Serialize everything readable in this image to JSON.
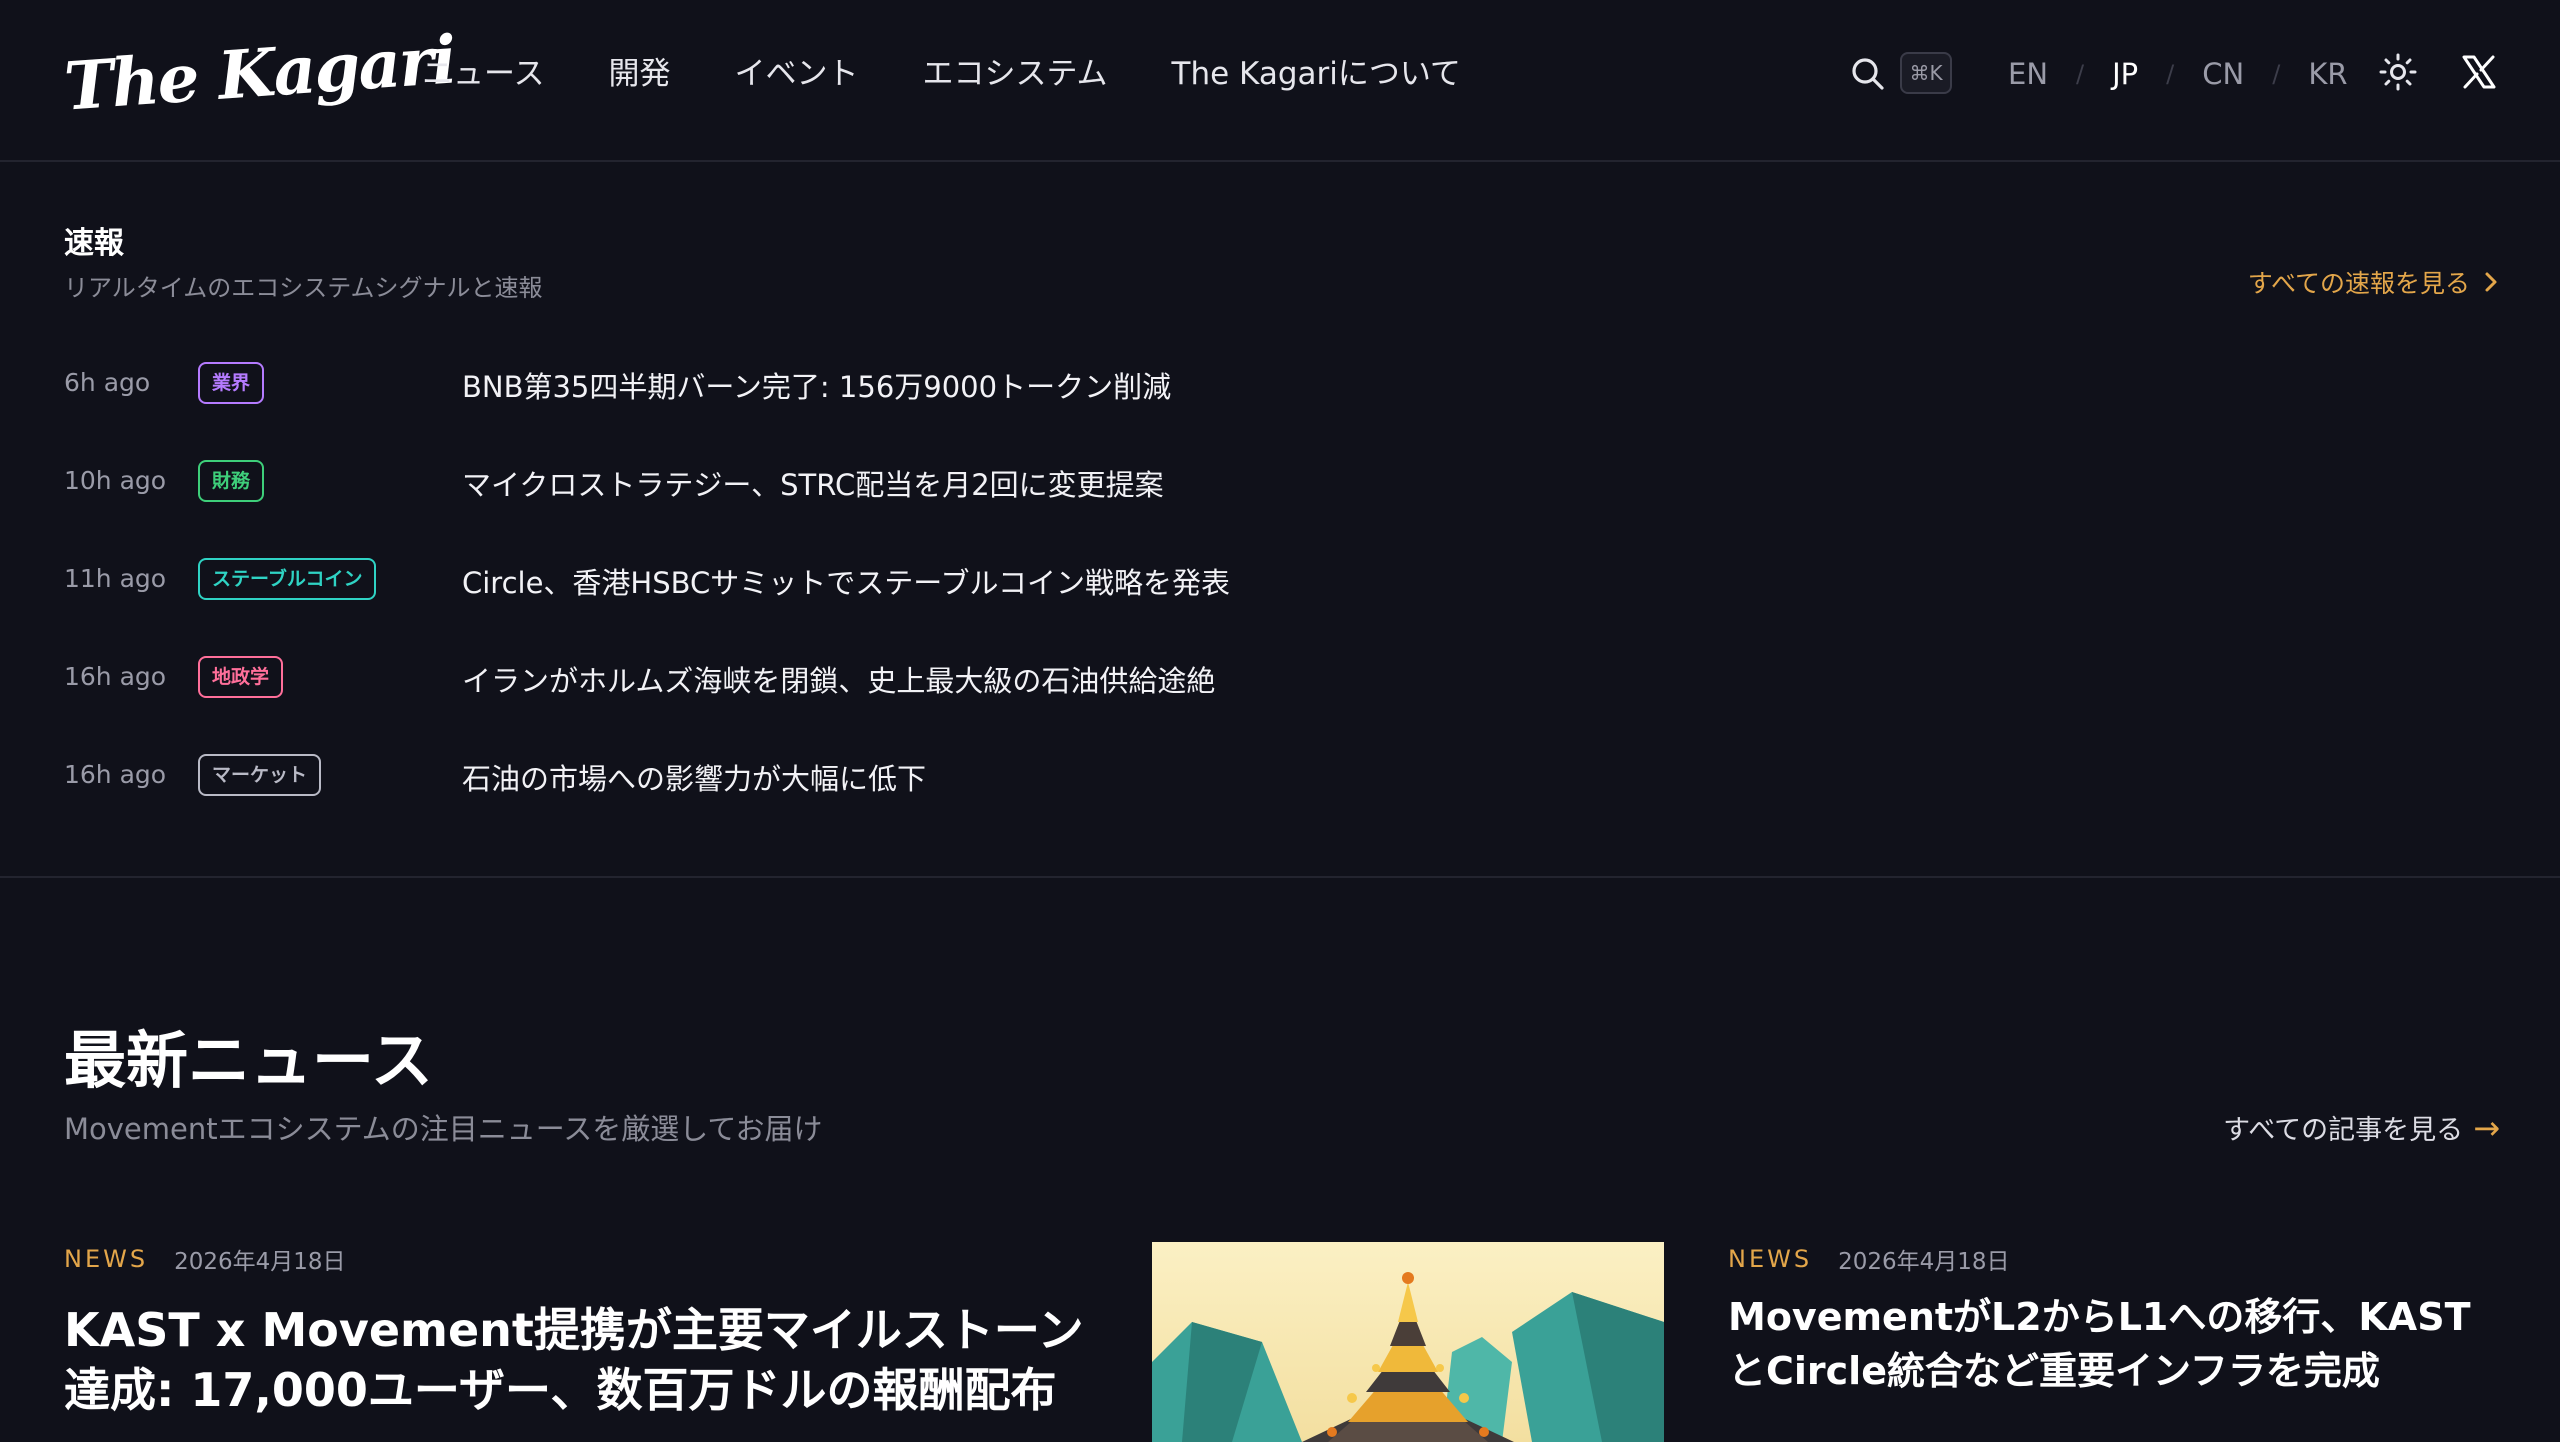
{
  "header": {
    "logo_text": "The Kagari",
    "nav": [
      "ニュース",
      "開発",
      "イベント",
      "エコシステム",
      "The Kagariについて"
    ],
    "search_shortcut": "⌘K",
    "languages": [
      "EN",
      "JP",
      "CN",
      "KR"
    ],
    "active_language": "JP",
    "icons": [
      "search-icon",
      "sun-icon",
      "x-logo-icon"
    ]
  },
  "breaking": {
    "title": "速報",
    "subtitle": "リアルタイムのエコシステムシグナルと速報",
    "see_all": "すべての速報を見る",
    "items": [
      {
        "time": "6h ago",
        "tag": "業界",
        "tag_color": "#b57bff",
        "headline": "BNB第35四半期バーン完了: 156万9000トークン削減"
      },
      {
        "time": "10h ago",
        "tag": "財務",
        "tag_color": "#3ecf7a",
        "headline": "マイクロストラテジー、STRC配当を月2回に変更提案"
      },
      {
        "time": "11h ago",
        "tag": "ステーブルコイン",
        "tag_color": "#2fd3c4",
        "headline": "Circle、香港HSBCサミットでステーブルコイン戦略を発表"
      },
      {
        "time": "16h ago",
        "tag": "地政学",
        "tag_color": "#ff6f9a",
        "headline": "イランがホルムズ海峡を閉鎖、史上最大級の石油供給途絶"
      },
      {
        "time": "16h ago",
        "tag": "マーケット",
        "tag_color": "#b9bac6",
        "headline": "石油の市場への影響力が大幅に低下"
      }
    ]
  },
  "latest": {
    "title": "最新ニュース",
    "subtitle": "Movementエコシステムの注目ニュースを厳選してお届け",
    "see_all": "すべての記事を見る",
    "see_all_arrow": "→",
    "featured": {
      "category": "NEWS",
      "date": "2026年4月18日",
      "title": "KAST x Movement提携が主要マイルストーン達成: 17,000ユーザー、数百万ドルの報酬配布"
    },
    "side": {
      "category": "NEWS",
      "date": "2026年4月18日",
      "title": "MovementがL2からL1への移行、KASTとCircle統合など重要インフラを完成"
    }
  }
}
